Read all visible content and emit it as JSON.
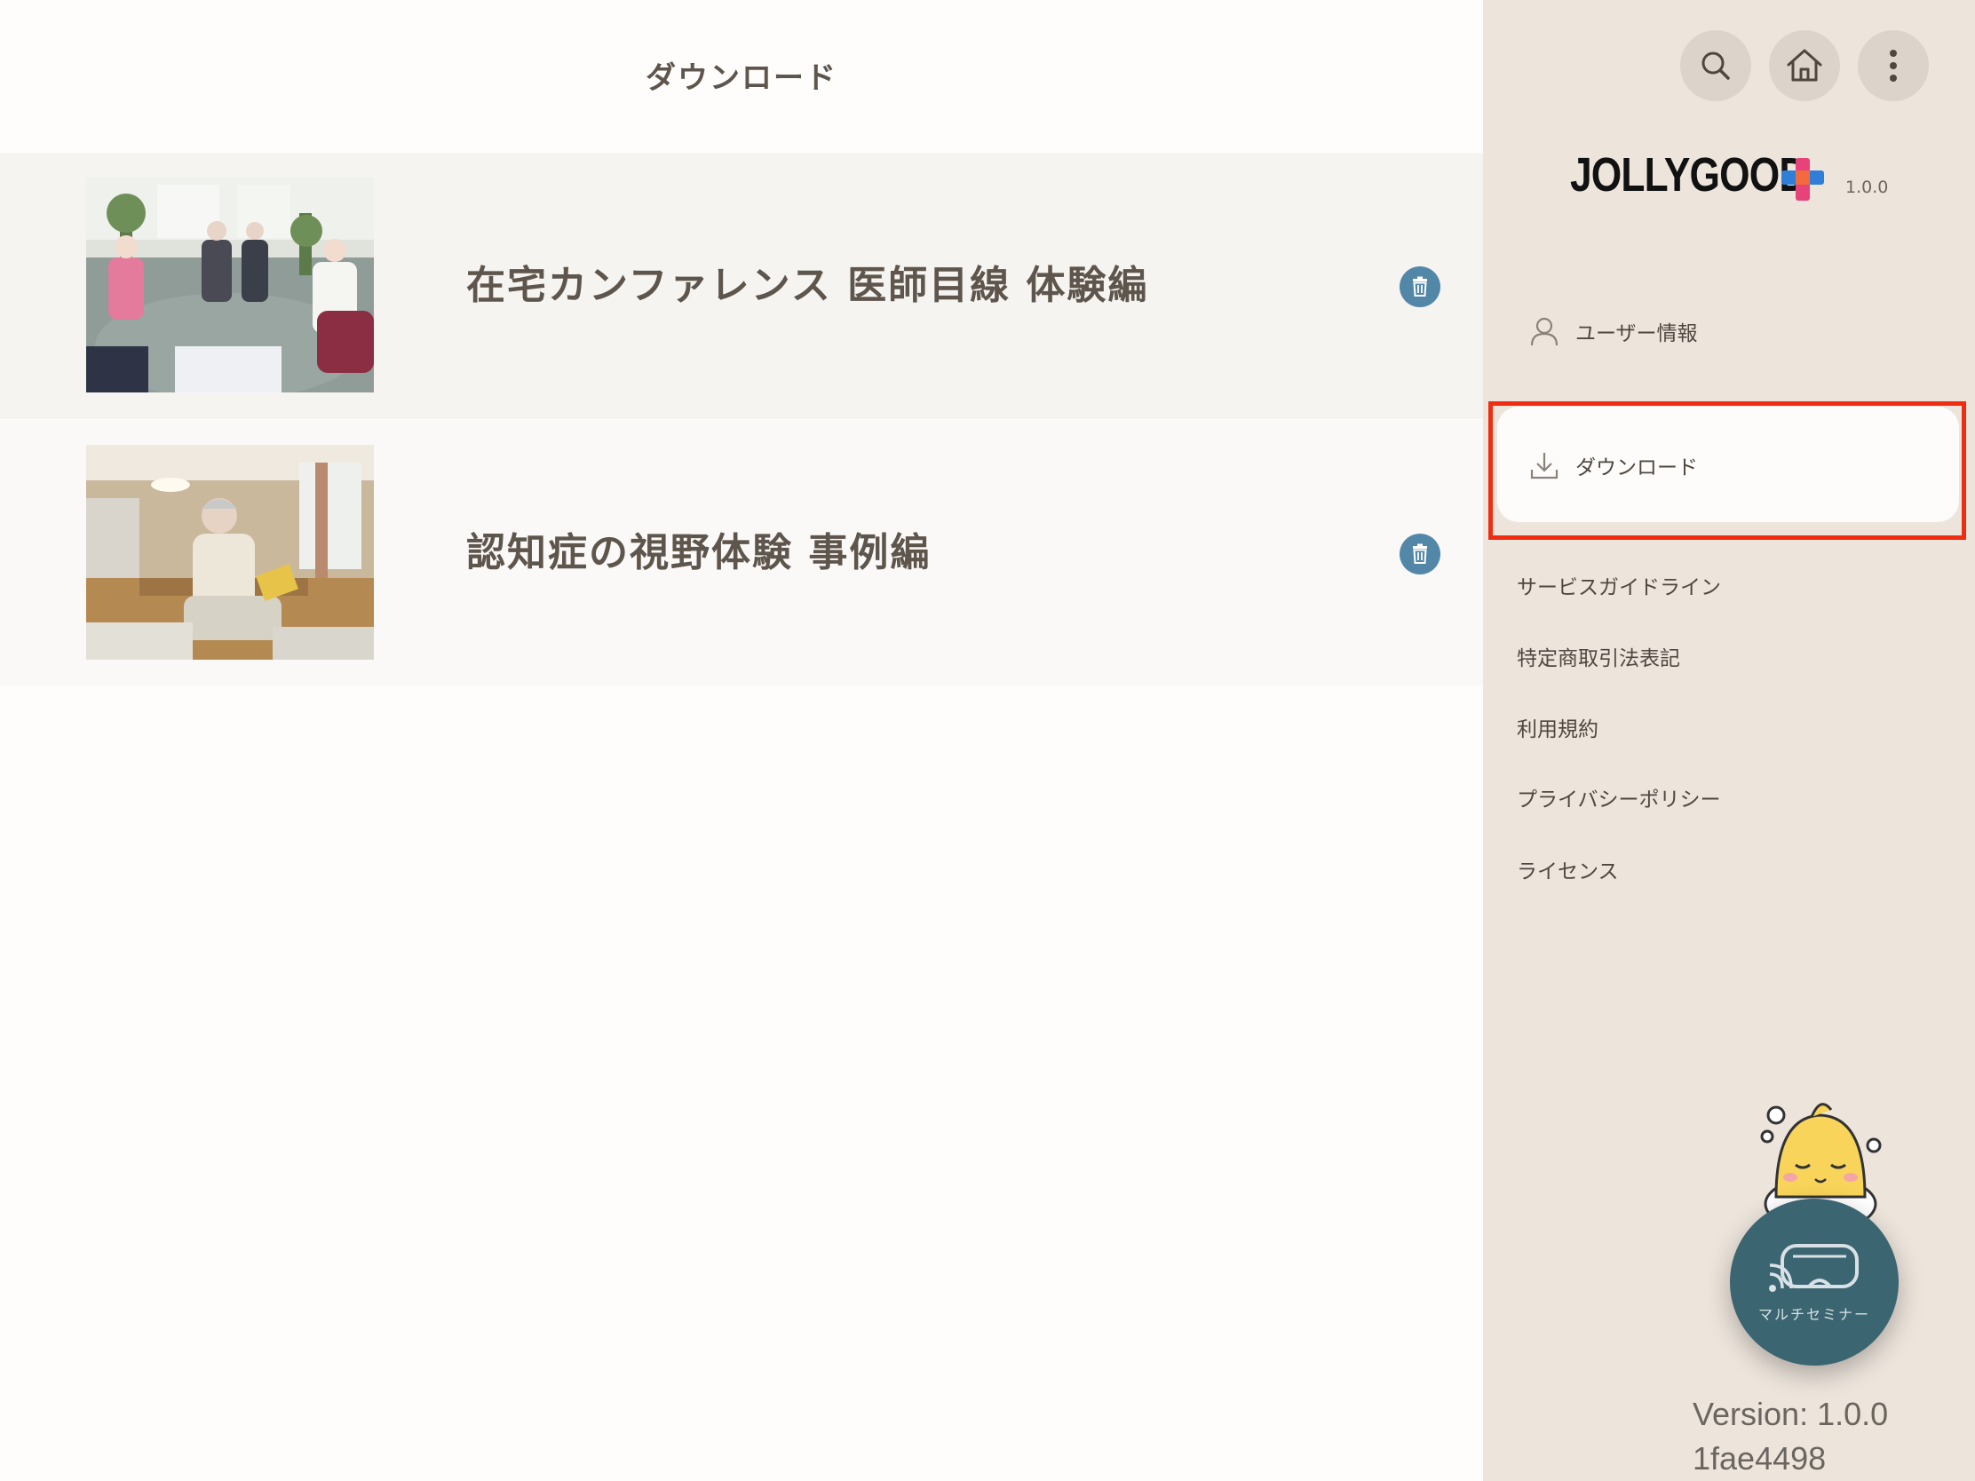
{
  "main": {
    "title": "ダウンロード",
    "items": [
      {
        "title": "在宅カンファレンス 医師目線 体験編",
        "thumbnail": "home-conference-360-thumbnail",
        "action_icon": "trash-icon"
      },
      {
        "title": "認知症の視野体験 事例編",
        "thumbnail": "dementia-vision-360-thumbnail",
        "action_icon": "trash-icon"
      }
    ]
  },
  "sidebar": {
    "top_buttons": [
      "search-icon",
      "home-icon",
      "more-vertical-icon"
    ],
    "logo_text": "JOLLYGOOD",
    "app_version": "1.0.0",
    "menu": {
      "user_info": "ユーザー情報",
      "download": "ダウンロード",
      "service_guideline": "サービスガイドライン",
      "commerce_law": "特定商取引法表記",
      "terms": "利用規約",
      "privacy_policy": "プライバシーポリシー",
      "license": "ライセンス"
    },
    "multi_seminar_label": "マルチセミナー",
    "build_version": "Version: 1.0.0",
    "build_hash": "1fae4498"
  },
  "colors": {
    "accent_blue": "#5387a8",
    "sidebar_bg": "#ede5dc",
    "highlight_red": "#ef2d12",
    "seminar_button": "#3c6572"
  }
}
